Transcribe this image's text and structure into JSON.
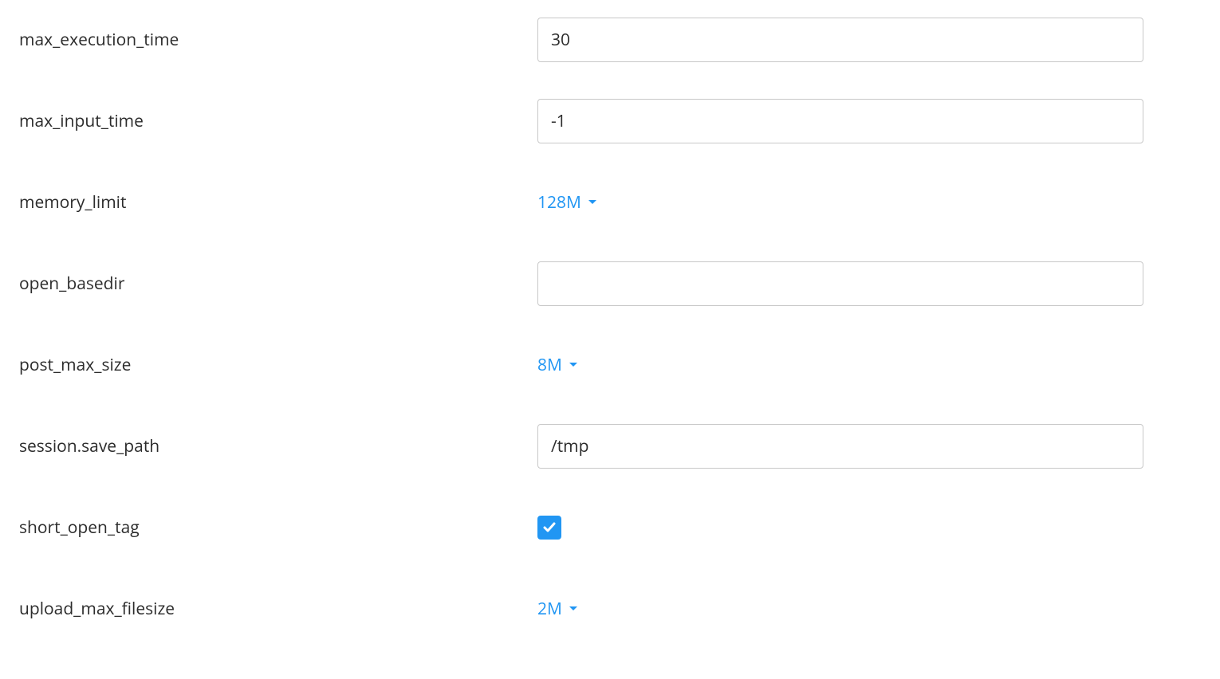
{
  "settings": {
    "max_execution_time": {
      "label": "max_execution_time",
      "value": "30"
    },
    "max_input_time": {
      "label": "max_input_time",
      "value": "-1"
    },
    "memory_limit": {
      "label": "memory_limit",
      "value": "128M"
    },
    "open_basedir": {
      "label": "open_basedir",
      "value": ""
    },
    "post_max_size": {
      "label": "post_max_size",
      "value": "8M"
    },
    "session_save_path": {
      "label": "session.save_path",
      "value": "/tmp"
    },
    "short_open_tag": {
      "label": "short_open_tag",
      "checked": true
    },
    "upload_max_filesize": {
      "label": "upload_max_filesize",
      "value": "2M"
    }
  },
  "colors": {
    "accent": "#2196f3",
    "text": "#2c2c2c",
    "border": "#c8c8c8"
  }
}
